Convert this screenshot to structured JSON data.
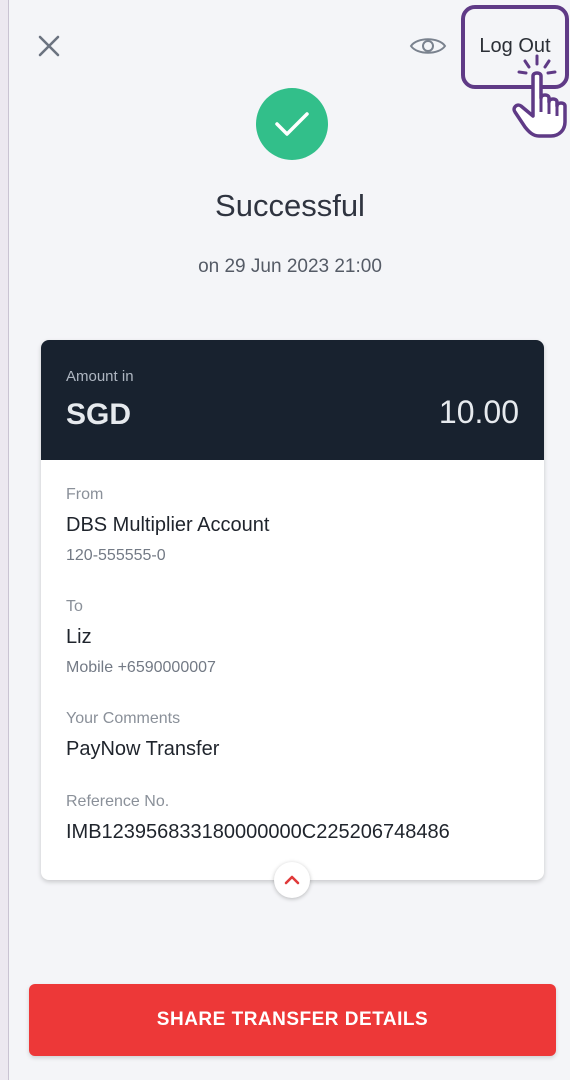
{
  "header": {
    "close_icon": "close-icon",
    "eye_icon": "eye-icon",
    "logout_label": "Log Out"
  },
  "status": {
    "icon": "check-icon",
    "title": "Successful",
    "date": "on 29 Jun 2023 21:00",
    "color": "#32bf8a"
  },
  "amount": {
    "label": "Amount in",
    "currency": "SGD",
    "value": "10.00"
  },
  "details": {
    "from": {
      "label": "From",
      "name": "DBS Multiplier Account",
      "account": "120-555555-0"
    },
    "to": {
      "label": "To",
      "name": "Liz",
      "mobile": "Mobile +6590000007"
    },
    "comments": {
      "label": "Your Comments",
      "value": "PayNow Transfer"
    },
    "reference": {
      "label": "Reference No.",
      "value": "IMB123956833180000000C225206748486"
    }
  },
  "actions": {
    "share_label": "SHARE TRANSFER DETAILS",
    "share_color": "#ed3838"
  },
  "colors": {
    "card_header": "#18222f",
    "highlight_border": "#5f3a86"
  }
}
